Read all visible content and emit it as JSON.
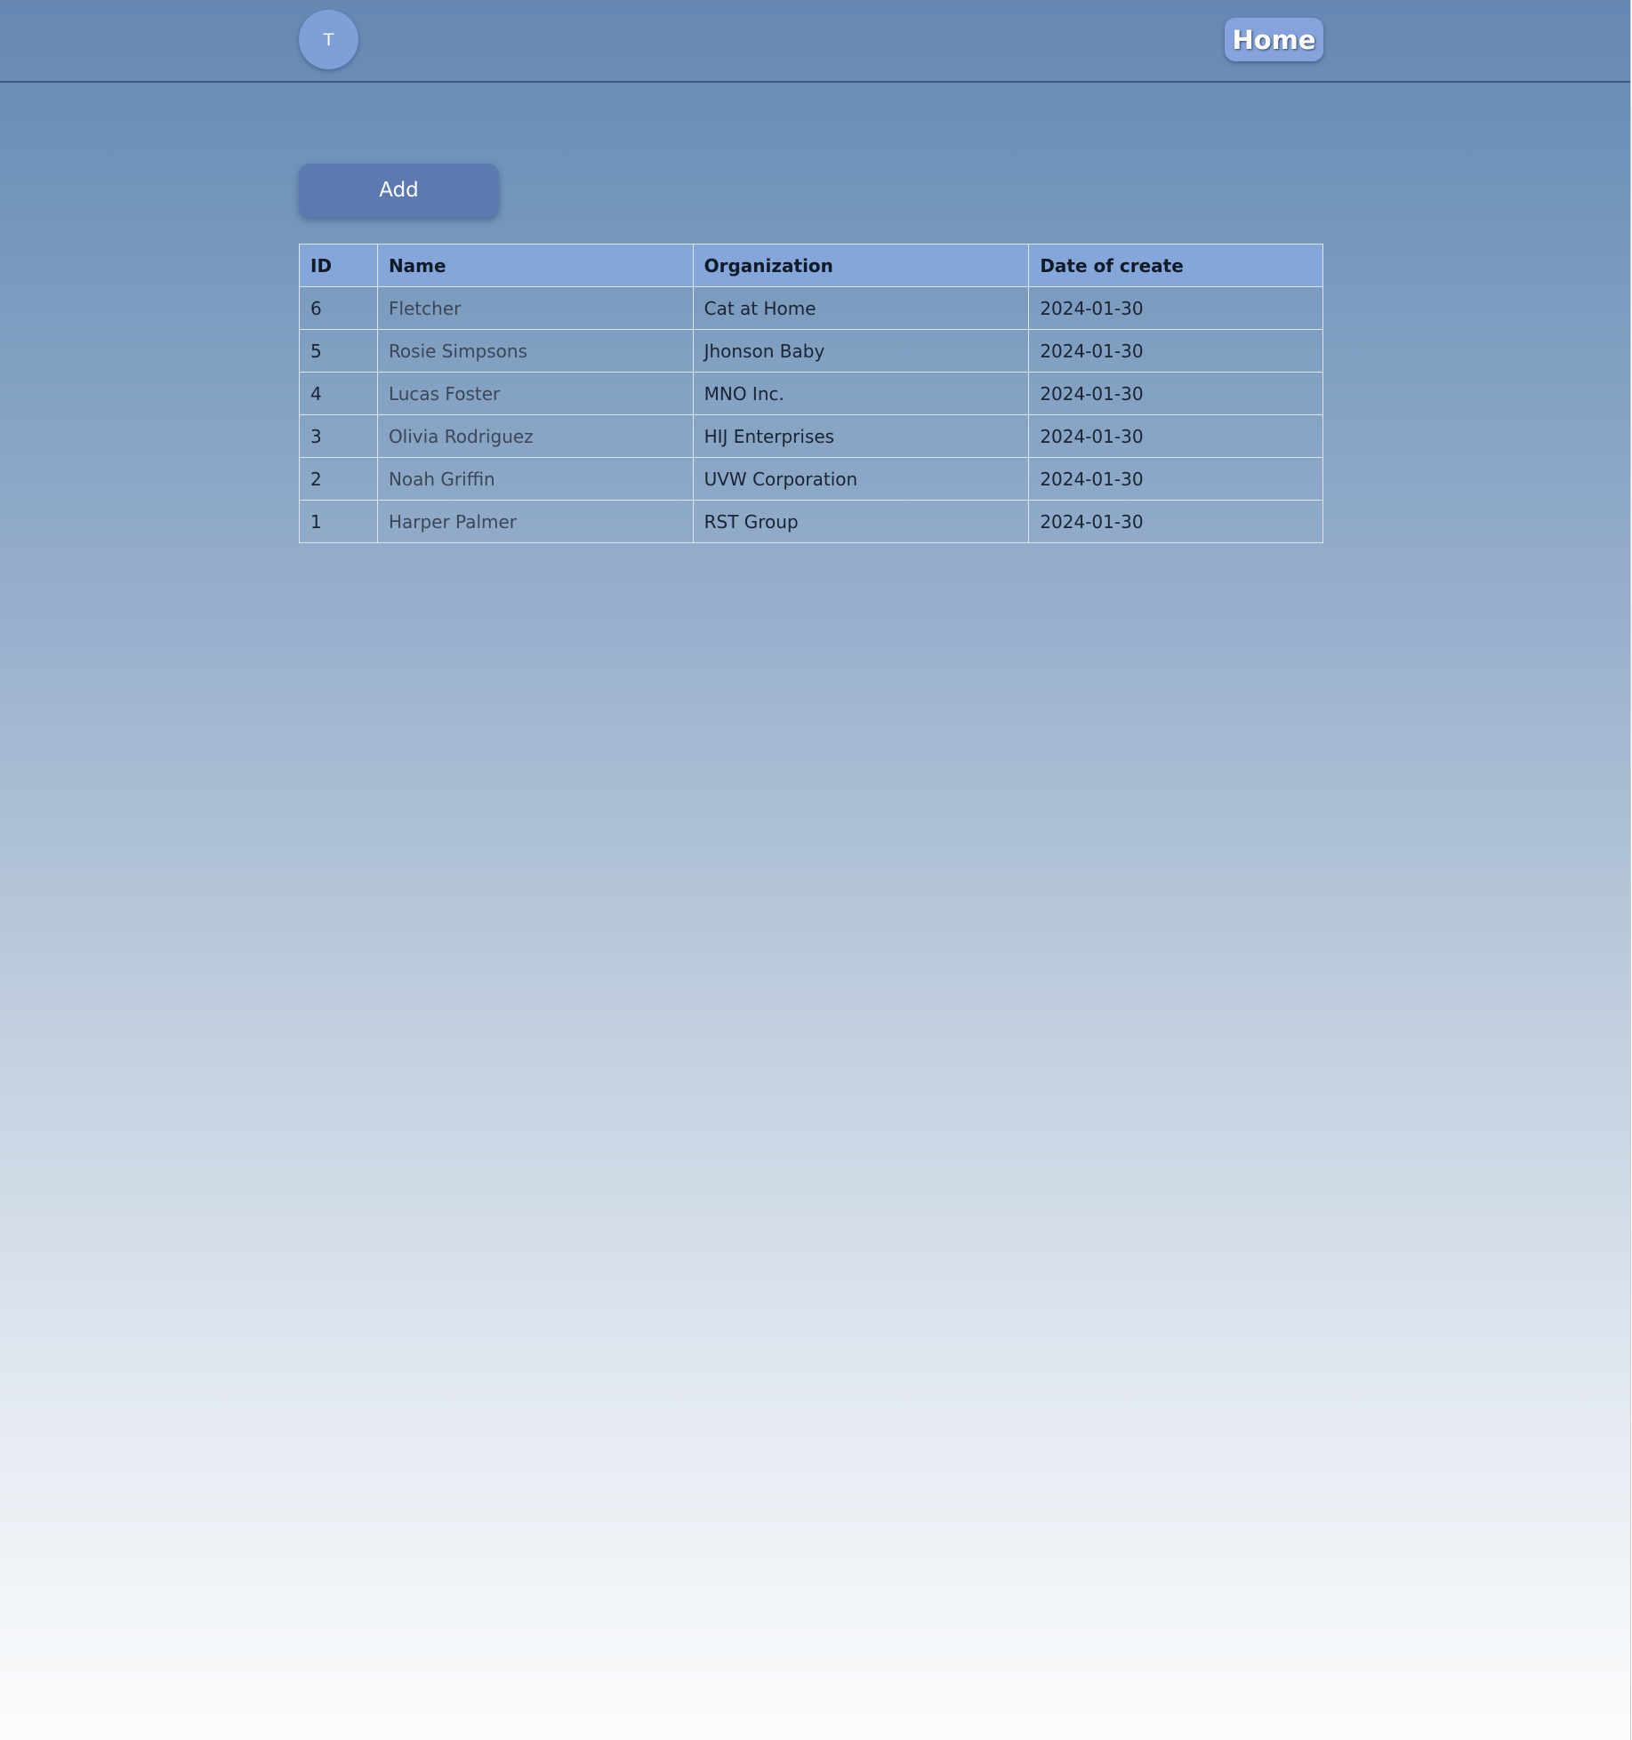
{
  "header": {
    "avatar_initial": "T",
    "home_label": "Home"
  },
  "main": {
    "add_label": "Add",
    "table": {
      "columns": [
        "ID",
        "Name",
        "Organization",
        "Date of create"
      ],
      "rows": [
        {
          "id": "6",
          "name": "Fletcher",
          "organization": "Cat at Home",
          "date": "2024-01-30"
        },
        {
          "id": "5",
          "name": "Rosie Simpsons",
          "organization": "Jhonson Baby",
          "date": "2024-01-30"
        },
        {
          "id": "4",
          "name": "Lucas Foster",
          "organization": "MNO Inc.",
          "date": "2024-01-30"
        },
        {
          "id": "3",
          "name": "Olivia Rodriguez",
          "organization": "HIJ Enterprises",
          "date": "2024-01-30"
        },
        {
          "id": "2",
          "name": "Noah Griffin",
          "organization": "UVW Corporation",
          "date": "2024-01-30"
        },
        {
          "id": "1",
          "name": "Harper Palmer",
          "organization": "RST Group",
          "date": "2024-01-30"
        }
      ]
    }
  },
  "colors": {
    "header_bg": "#6688b3",
    "avatar_bg": "#7e9fd8",
    "home_bg": "#85a3dc",
    "add_bg": "#5a7ab0",
    "table_header_bg": "#84a6d8"
  }
}
